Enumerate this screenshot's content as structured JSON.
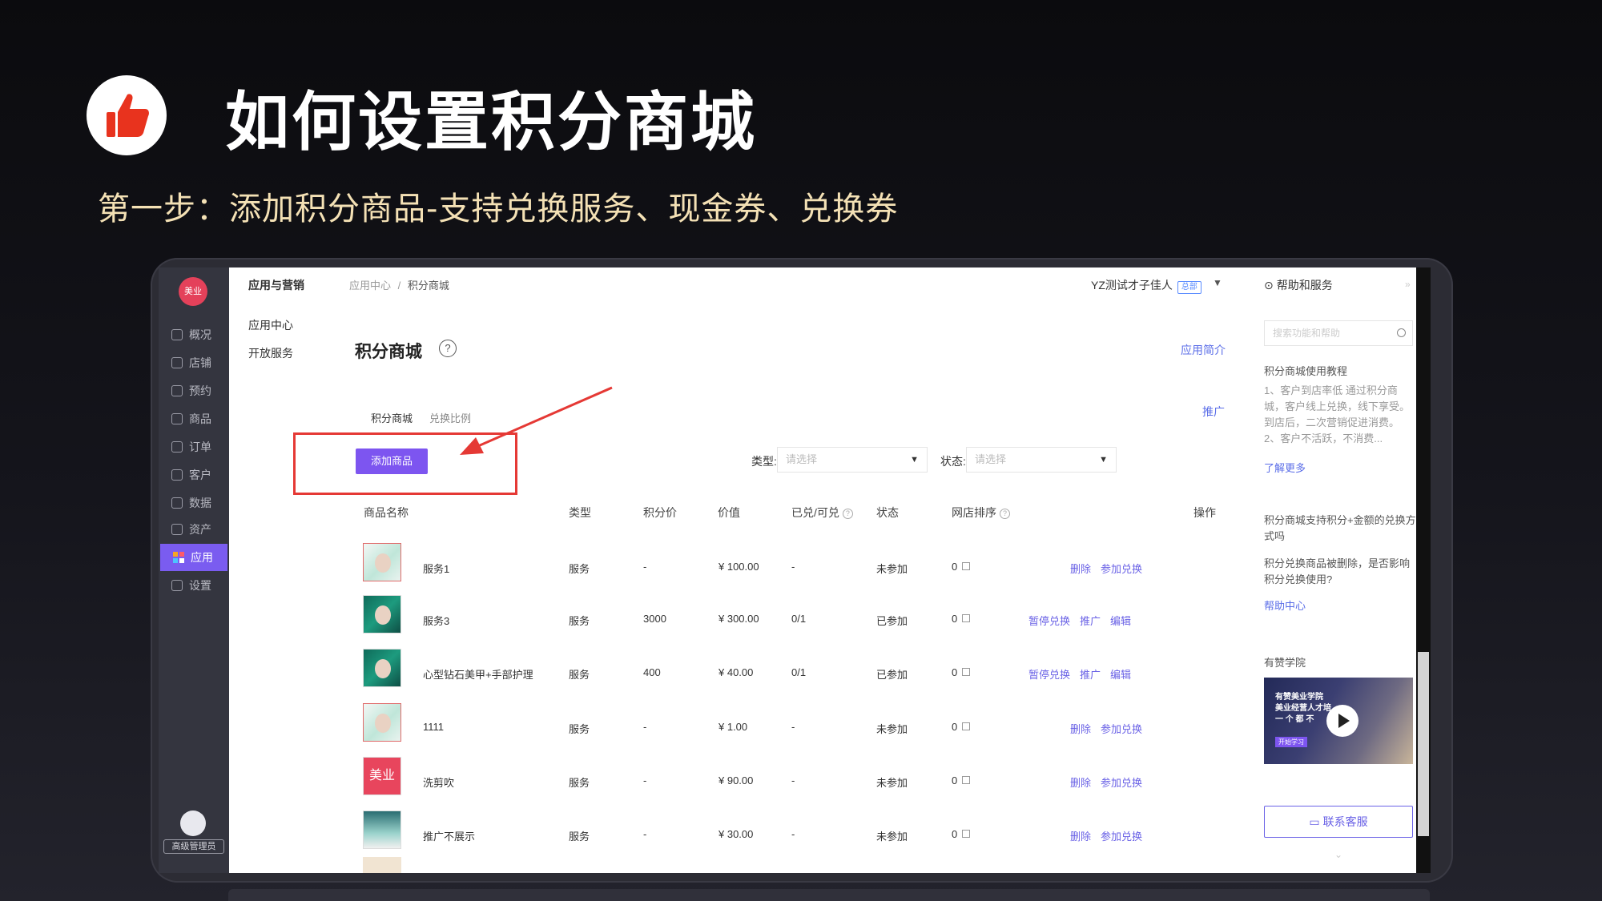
{
  "slide": {
    "title": "如何设置积分商城",
    "subtitle": "第一步：添加积分商品-支持兑换服务、现金券、兑换券"
  },
  "sidebar": {
    "logo": "美业",
    "items": [
      {
        "label": "概况",
        "icon": "dashboard-icon"
      },
      {
        "label": "店铺",
        "icon": "store-icon"
      },
      {
        "label": "预约",
        "icon": "calendar-icon"
      },
      {
        "label": "商品",
        "icon": "bag-icon"
      },
      {
        "label": "订单",
        "icon": "order-icon"
      },
      {
        "label": "客户",
        "icon": "user-icon"
      },
      {
        "label": "数据",
        "icon": "chart-icon"
      },
      {
        "label": "资产",
        "icon": "wallet-icon"
      },
      {
        "label": "应用",
        "icon": "apps-icon",
        "active": true
      },
      {
        "label": "设置",
        "icon": "gear-icon"
      }
    ],
    "role": "高级管理员"
  },
  "topbar": {
    "title": "应用与营销",
    "breadcrumb_parent": "应用中心",
    "breadcrumb_sep": "/",
    "breadcrumb_current": "积分商城",
    "shop_name": "YZ测试才子佳人",
    "shop_tag": "总部",
    "caret": "▼"
  },
  "subnav": [
    "应用中心",
    "开放服务"
  ],
  "main": {
    "title": "积分商城",
    "help_glyph": "?",
    "intro_link": "应用简介",
    "promo_link": "推广",
    "tabs": [
      "积分商城",
      "兑换比例"
    ],
    "add_button": "添加商品",
    "filter_type_label": "类型:",
    "filter_status_label": "状态:",
    "select_placeholder": "请选择",
    "columns": [
      "商品名称",
      "类型",
      "积分价",
      "价值",
      "已兑/可兑",
      "状态",
      "网店排序",
      "操作"
    ],
    "rows": [
      {
        "name": "服务1",
        "type": "服务",
        "points": "-",
        "value": "¥ 100.00",
        "redeemed": "-",
        "status": "未参加",
        "sort": "0",
        "actions": [
          "删除",
          "参加兑换"
        ],
        "thumb": "light"
      },
      {
        "name": "服务3",
        "type": "服务",
        "points": "3000",
        "value": "¥ 300.00",
        "redeemed": "0/1",
        "status": "已参加",
        "sort": "0",
        "actions": [
          "暂停兑换",
          "推广",
          "编辑"
        ],
        "thumb": "green"
      },
      {
        "name": "心型钻石美甲+手部护理",
        "type": "服务",
        "points": "400",
        "value": "¥ 40.00",
        "redeemed": "0/1",
        "status": "已参加",
        "sort": "0",
        "actions": [
          "暂停兑换",
          "推广",
          "编辑"
        ],
        "thumb": "green"
      },
      {
        "name": "1111",
        "type": "服务",
        "points": "-",
        "value": "¥ 1.00",
        "redeemed": "-",
        "status": "未参加",
        "sort": "0",
        "actions": [
          "删除",
          "参加兑换"
        ],
        "thumb": "light"
      },
      {
        "name": "洗剪吹",
        "type": "服务",
        "points": "-",
        "value": "¥ 90.00",
        "redeemed": "-",
        "status": "未参加",
        "sort": "0",
        "actions": [
          "删除",
          "参加兑换"
        ],
        "thumb": "red",
        "thumb_text": "美业"
      },
      {
        "name": "推广不展示",
        "type": "服务",
        "points": "-",
        "value": "¥ 30.00",
        "redeemed": "-",
        "status": "未参加",
        "sort": "0",
        "actions": [
          "删除",
          "参加兑换"
        ],
        "thumb": "teal"
      }
    ]
  },
  "help_panel": {
    "title": "帮助和服务",
    "close": "»",
    "search_placeholder": "搜索功能和帮助",
    "tutorial_title": "积分商城使用教程",
    "tutorial_text": "1、客户到店率低 通过积分商城，客户线上兑换，线下享受。到店后，二次营销促进消费。 2、客户不活跃，不消费...",
    "learn_more": "了解更多",
    "faq1": "积分商城支持积分+金额的兑换方式吗",
    "faq2": "积分兑换商品被删除，是否影响积分兑换使用?",
    "help_center": "帮助中心",
    "academy_title": "有赞学院",
    "video_title": "有赞美业学院\n美业经营人才培\n一 个 都 不",
    "video_tag": "开始学习",
    "contact": "联系客服",
    "down": "⌄"
  },
  "colors": {
    "accent": "#7d55f0",
    "link": "#6a62e6",
    "highlight": "#e53935",
    "subtitle": "#f4e1b5"
  }
}
